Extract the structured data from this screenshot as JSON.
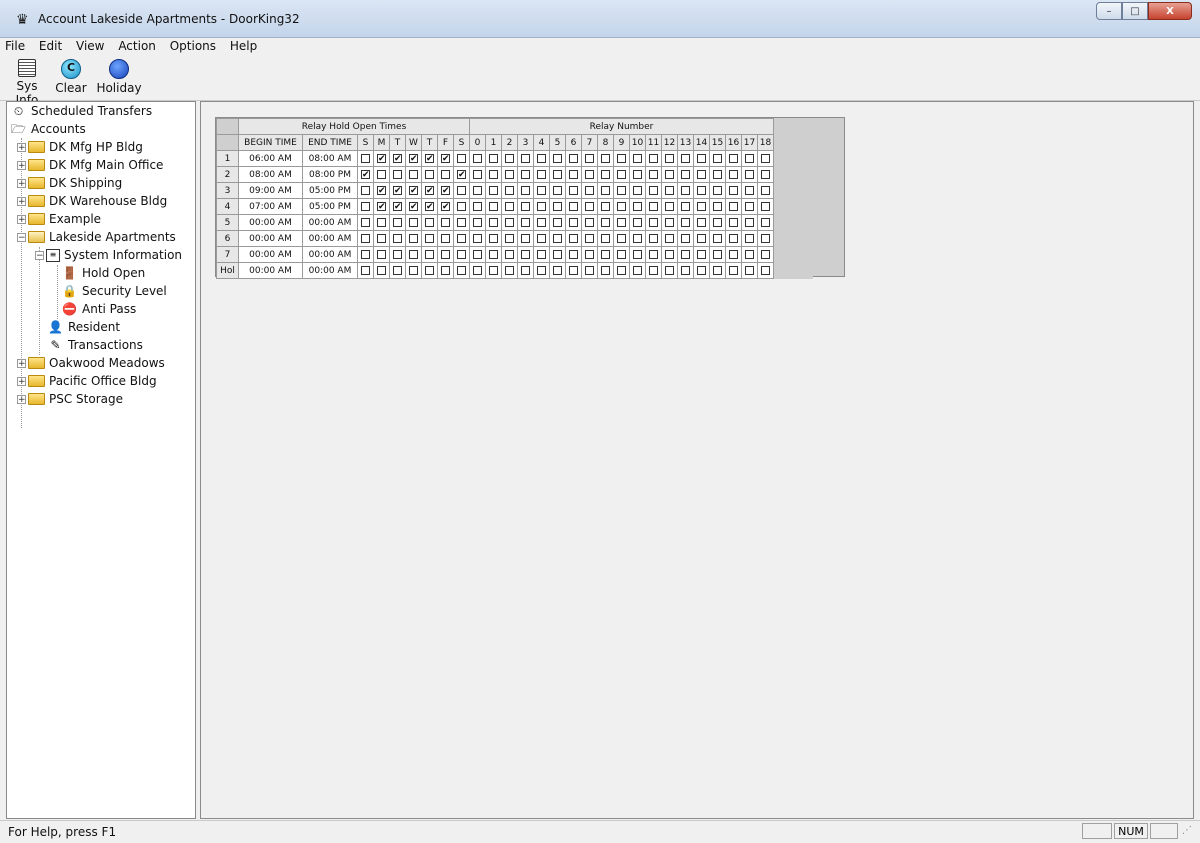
{
  "window": {
    "title": "Account Lakeside Apartments - DoorKing32",
    "min_label": "–",
    "max_label": "□",
    "close_label": "X"
  },
  "menu": [
    {
      "label": "File"
    },
    {
      "label": "Edit"
    },
    {
      "label": "View"
    },
    {
      "label": "Action"
    },
    {
      "label": "Options"
    },
    {
      "label": "Help"
    }
  ],
  "toolbar": {
    "sysinfo": "Sys Info",
    "clear": "Clear",
    "holiday": "Holiday"
  },
  "tree": {
    "scheduled_transfers": "Scheduled Transfers",
    "accounts": "Accounts",
    "dk_mfg_hp": "DK Mfg HP Bldg",
    "dk_mfg_main": "DK Mfg Main Office",
    "dk_shipping": "DK Shipping",
    "dk_warehouse": "DK Warehouse Bldg",
    "example": "Example",
    "lakeside": "Lakeside Apartments",
    "system_information": "System Information",
    "hold_open": "Hold Open",
    "security_level": "Security Level",
    "anti_pass": "Anti Pass",
    "resident": "Resident",
    "transactions": "Transactions",
    "oakwood": "Oakwood Meadows",
    "pacific": "Pacific Office Bldg",
    "psc": "PSC Storage"
  },
  "grid": {
    "group_hold": "Relay Hold Open Times",
    "group_relay": "Relay Number",
    "col_begin": "BEGIN TIME",
    "col_end": "END TIME",
    "days": [
      "S",
      "M",
      "T",
      "W",
      "T",
      "F",
      "S"
    ],
    "relays": [
      "0",
      "1",
      "2",
      "3",
      "4",
      "5",
      "6",
      "7",
      "8",
      "9",
      "10",
      "11",
      "12",
      "13",
      "14",
      "15",
      "16",
      "17",
      "18"
    ],
    "rows": [
      {
        "id": "1",
        "begin": "06:00 AM",
        "end": "08:00 AM",
        "days": [
          0,
          1,
          1,
          1,
          1,
          1,
          0
        ]
      },
      {
        "id": "2",
        "begin": "08:00 AM",
        "end": "08:00 PM",
        "days": [
          1,
          0,
          0,
          0,
          0,
          0,
          1
        ]
      },
      {
        "id": "3",
        "begin": "09:00 AM",
        "end": "05:00 PM",
        "days": [
          0,
          1,
          1,
          1,
          1,
          1,
          0
        ]
      },
      {
        "id": "4",
        "begin": "07:00 AM",
        "end": "05:00 PM",
        "days": [
          0,
          1,
          1,
          1,
          1,
          1,
          0
        ]
      },
      {
        "id": "5",
        "begin": "00:00 AM",
        "end": "00:00 AM",
        "days": [
          0,
          0,
          0,
          0,
          0,
          0,
          0
        ]
      },
      {
        "id": "6",
        "begin": "00:00 AM",
        "end": "00:00 AM",
        "days": [
          0,
          0,
          0,
          0,
          0,
          0,
          0
        ]
      },
      {
        "id": "7",
        "begin": "00:00 AM",
        "end": "00:00 AM",
        "days": [
          0,
          0,
          0,
          0,
          0,
          0,
          0
        ]
      },
      {
        "id": "Hol",
        "begin": "00:00 AM",
        "end": "00:00 AM",
        "days": [
          0,
          0,
          0,
          0,
          0,
          0,
          0
        ]
      }
    ]
  },
  "status": {
    "help": "For Help, press F1",
    "num": "NUM"
  }
}
